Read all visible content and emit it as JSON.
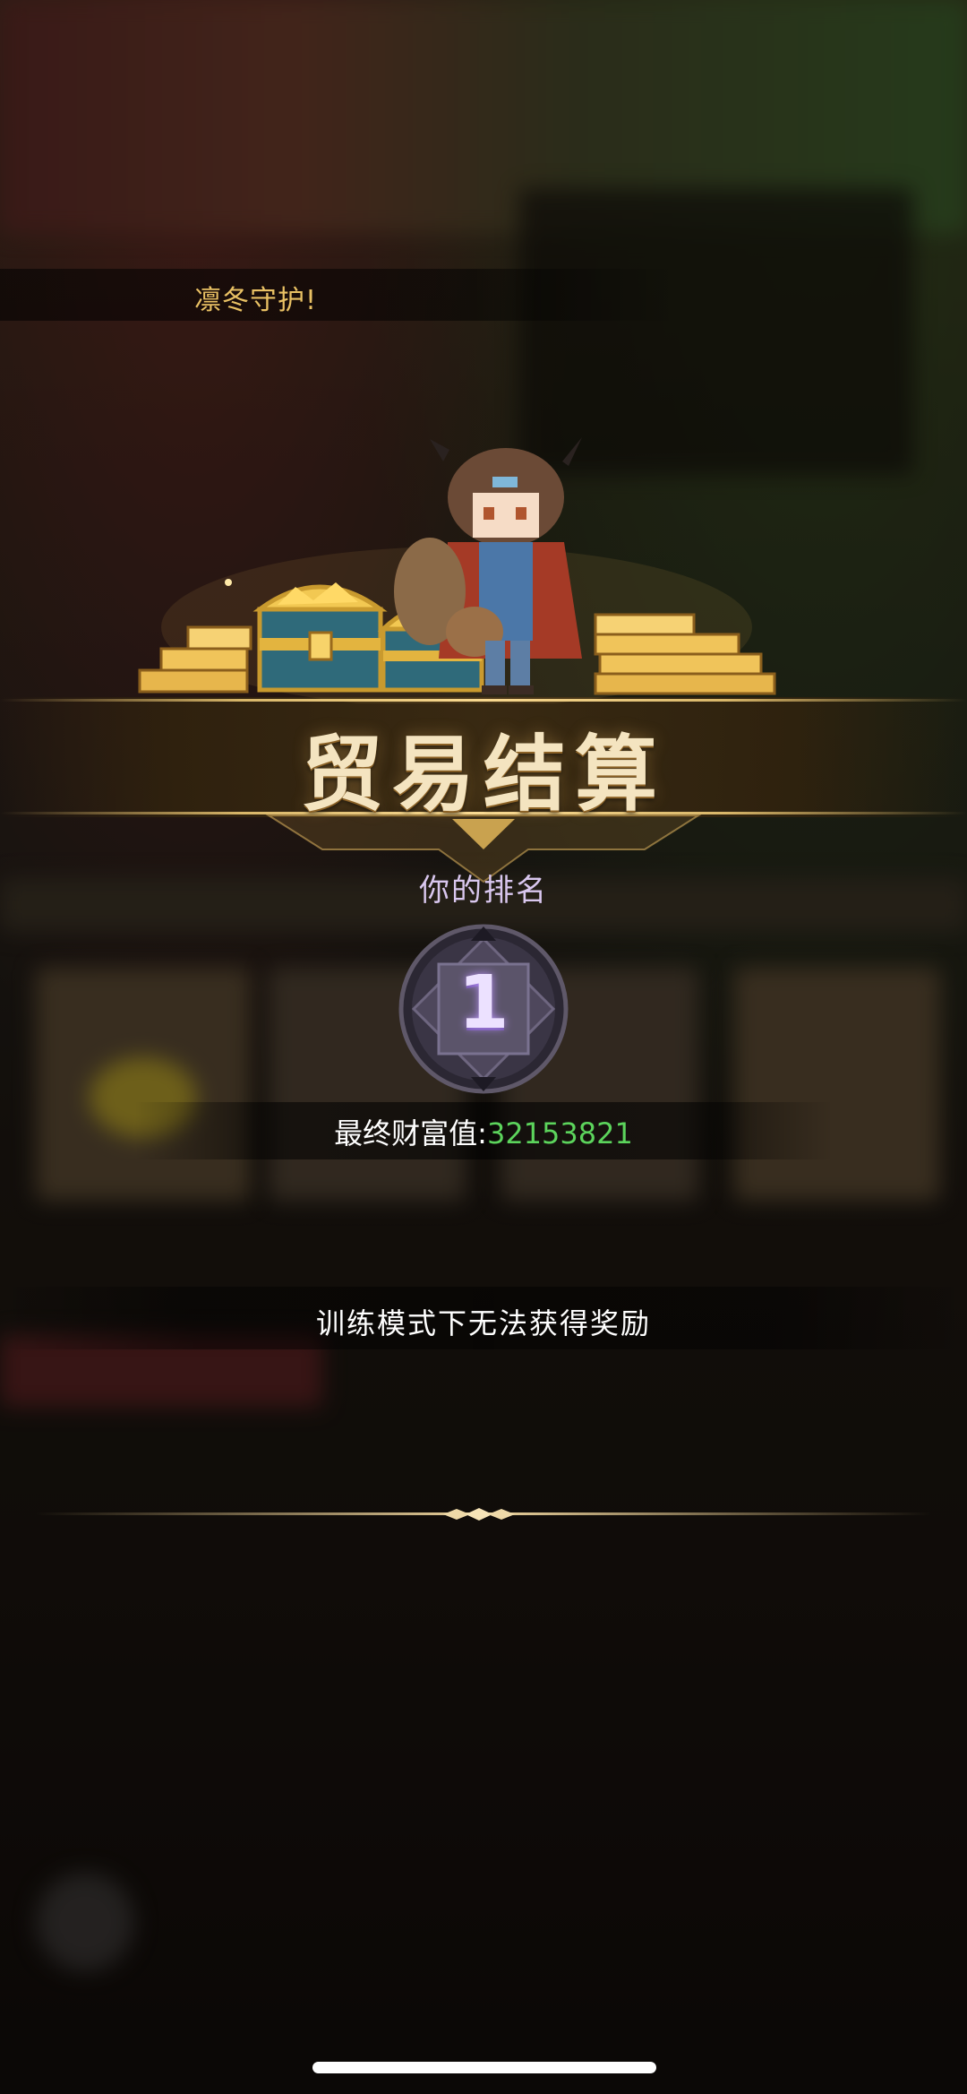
{
  "banner": {
    "text": "凛冬守护!"
  },
  "result": {
    "title": "贸易结算",
    "rank_label": "你的排名",
    "rank_value": "1",
    "wealth_label": "最终财富值:",
    "wealth_value": "32153821",
    "notice": "训练模式下无法获得奖励"
  },
  "colors": {
    "banner_text": "#e9c164",
    "title_text": "#f4e4c0",
    "rank_label": "#d9c7ef",
    "wealth_value": "#5cd45c",
    "accent_gold": "#e1be6e"
  },
  "icons": {
    "illustration": "character-with-treasure-chests-and-gold-bars",
    "rank_badge": "octagonal-rank-emblem",
    "divider": "ornate-divider-icon"
  }
}
